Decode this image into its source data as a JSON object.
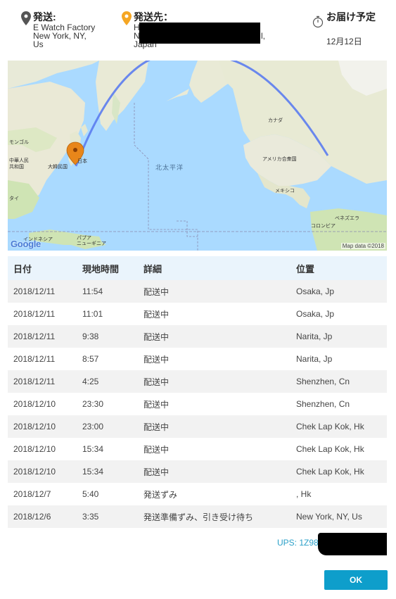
{
  "header": {
    "from": {
      "title": "発送:",
      "lines": [
        "E Watch Factory",
        "New York, NY,",
        "Us"
      ],
      "icon": "location-pin-icon",
      "icon_color": "#555555"
    },
    "to": {
      "title": "発送先：",
      "line1": "H",
      "line2": "N",
      "line2_tail": "l,",
      "line3": "Japan",
      "icon": "location-pin-icon",
      "icon_color": "#f5a623"
    },
    "eta": {
      "title": "お届け予定",
      "date": "12月12日",
      "icon": "stopwatch-icon"
    }
  },
  "map": {
    "labels": {
      "mongolia": "モンゴル",
      "china": "中華人民\n共和国",
      "korea": "大韓民国",
      "japan": "日本",
      "thailand": "タイ",
      "indonesia": "インドネシア",
      "papua": "パプア\nニューギニア",
      "pacific": "北太平洋",
      "canada": "カナダ",
      "usa": "アメリカ合衆国",
      "mexico": "メキシコ",
      "venezuela": "ベネズエラ",
      "colombia": "コロンビア"
    },
    "attribution": "Map data ©2018",
    "provider": "Google",
    "route_color": "#5b7cf0",
    "marker_color": "#e8861a"
  },
  "table": {
    "headers": [
      "日付",
      "現地時間",
      "詳細",
      "位置"
    ],
    "rows": [
      [
        "2018/12/11",
        "11:54",
        "配送中",
        "Osaka, Jp"
      ],
      [
        "2018/12/11",
        "11:01",
        "配送中",
        "Osaka, Jp"
      ],
      [
        "2018/12/11",
        "9:38",
        "配送中",
        "Narita, Jp"
      ],
      [
        "2018/12/11",
        "8:57",
        "配送中",
        "Narita, Jp"
      ],
      [
        "2018/12/11",
        "4:25",
        "配送中",
        "Shenzhen, Cn"
      ],
      [
        "2018/12/10",
        "23:30",
        "配送中",
        "Shenzhen, Cn"
      ],
      [
        "2018/12/10",
        "23:00",
        "配送中",
        "Chek Lap Kok, Hk"
      ],
      [
        "2018/12/10",
        "15:34",
        "配送中",
        "Chek Lap Kok, Hk"
      ],
      [
        "2018/12/10",
        "15:34",
        "配送中",
        "Chek Lap Kok, Hk"
      ],
      [
        "2018/12/7",
        "5:40",
        "発送ずみ",
        ", Hk"
      ],
      [
        "2018/12/6",
        "3:35",
        "発送準備ずみ、引き受け待ち",
        "New York, NY, Us"
      ]
    ]
  },
  "tracking": {
    "label": "UPS: 1Z98",
    "color": "#2aa0c8"
  },
  "ok_button": {
    "label": "OK",
    "color": "#0e9ecb"
  }
}
